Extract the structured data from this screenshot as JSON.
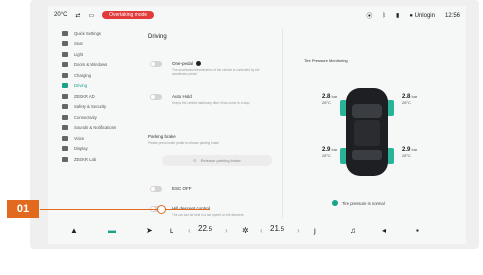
{
  "statusbar": {
    "temperature": "20°C",
    "alert": "Overtaking mode",
    "user": "Unlogin",
    "time": "12:56"
  },
  "sidebar": {
    "items": [
      {
        "label": "Quick Settings",
        "active": false
      },
      {
        "label": "Seat",
        "active": false
      },
      {
        "label": "Light",
        "active": false
      },
      {
        "label": "Doors & Windows",
        "active": false
      },
      {
        "label": "Charging",
        "active": false
      },
      {
        "label": "Driving",
        "active": true
      },
      {
        "label": "ZEEKR AD",
        "active": false
      },
      {
        "label": "Safety & Security",
        "active": false
      },
      {
        "label": "Connectivity",
        "active": false
      },
      {
        "label": "Sounds & Notifications",
        "active": false
      },
      {
        "label": "Voice",
        "active": false
      },
      {
        "label": "Display",
        "active": false
      },
      {
        "label": "ZEEKR Lab",
        "active": false
      }
    ]
  },
  "main": {
    "title": "Driving",
    "one_pedal": {
      "label": "One-pedal",
      "desc": "The accelerator/deceleration of the vehicle is controlled by the accelerator pedal"
    },
    "auto_hold": {
      "label": "Auto Hold",
      "desc": "Keeps the vehicle stationary after it has come to a stop"
    },
    "parking_brake": {
      "label": "Parking brake",
      "desc": "Please press brake pedal to release parking brake",
      "button": "Release parking brake"
    },
    "esc_off": {
      "label": "ESC OFF"
    },
    "hill_descent": {
      "label": "Hill descent control",
      "desc": "The car can be held in a set speed on hill descents"
    }
  },
  "tires": {
    "title": "Tire Pressure Monitoring",
    "front_left": {
      "pressure": "2.8",
      "temp": "28°C"
    },
    "front_right": {
      "pressure": "2.8",
      "temp": "28°C"
    },
    "rear_left": {
      "pressure": "2.9",
      "temp": "28°C"
    },
    "rear_right": {
      "pressure": "2.9",
      "temp": "28°C"
    },
    "unit": "bar",
    "status": "Tire pressure is normal"
  },
  "dock": {
    "left_temp": "22",
    "left_temp_decimal": ".5",
    "right_temp": "21",
    "right_temp_decimal": ".5"
  },
  "callout": {
    "label": "01"
  },
  "colors": {
    "accent": "#1aa38a",
    "callout": "#e26a1f",
    "alert": "#e23b3b"
  }
}
